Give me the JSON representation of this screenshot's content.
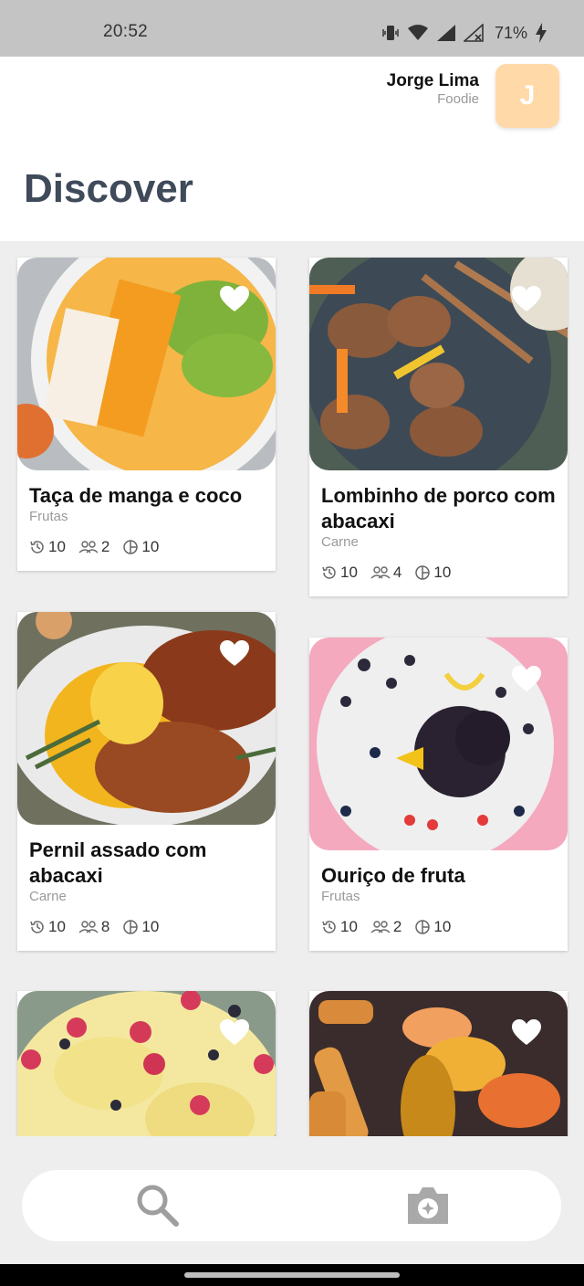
{
  "status_bar": {
    "time": "20:52",
    "battery": "71%"
  },
  "header": {
    "user_name": "Jorge Lima",
    "user_role": "Foodie",
    "avatar_initial": "J",
    "title": "Discover"
  },
  "recipes": [
    {
      "title": "Taça de manga e coco",
      "category": "Frutas",
      "time": "10",
      "servings": "2",
      "portions": "10"
    },
    {
      "title": "Lombinho de porco com abacaxi",
      "category": "Carne",
      "time": "10",
      "servings": "4",
      "portions": "10"
    },
    {
      "title": "Pernil assado com abacaxi",
      "category": "Carne",
      "time": "10",
      "servings": "8",
      "portions": "10"
    },
    {
      "title": "Ouriço de fruta",
      "category": "Frutas",
      "time": "10",
      "servings": "2",
      "portions": "10"
    }
  ],
  "nav": {
    "search_icon": "search-icon",
    "camera_icon": "camera-icon"
  },
  "colors": {
    "accent_avatar": "#ffd9a8",
    "title": "#3f4a5a"
  }
}
